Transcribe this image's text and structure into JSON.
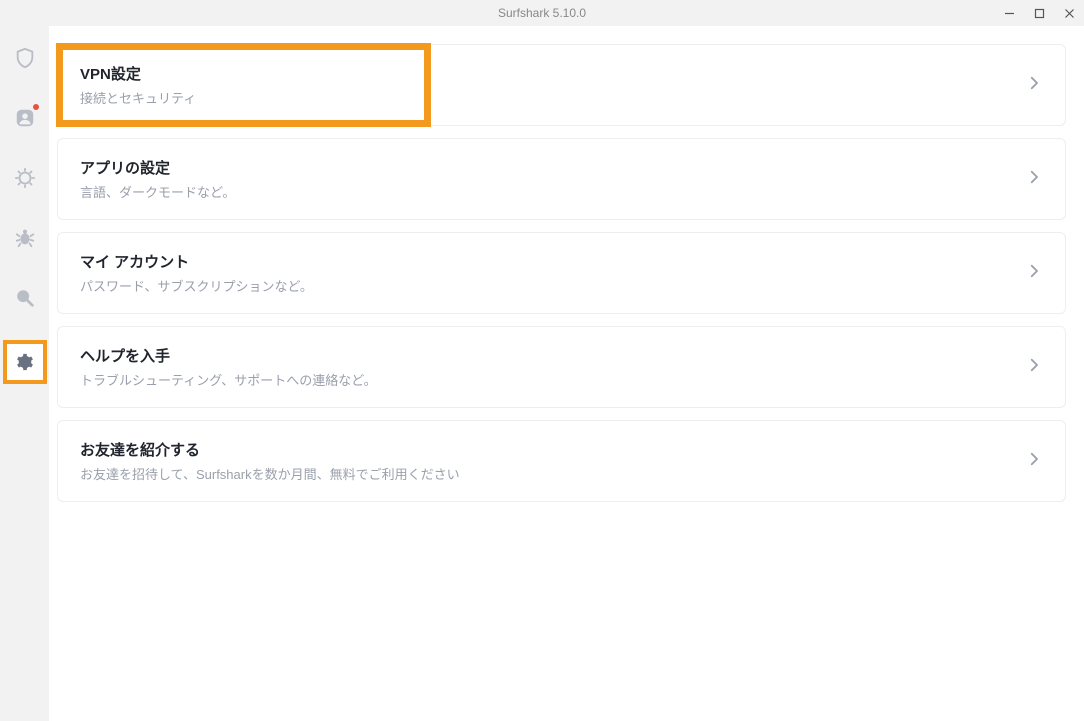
{
  "titlebar": {
    "title": "Surfshark 5.10.0"
  },
  "sidebar": {
    "items": [
      {
        "name": "shield-icon",
        "has_dot": false
      },
      {
        "name": "user-icon",
        "has_dot": true
      },
      {
        "name": "alert-icon",
        "has_dot": false
      },
      {
        "name": "antivirus-icon",
        "has_dot": false
      },
      {
        "name": "search-icon",
        "has_dot": false
      },
      {
        "name": "gear-icon",
        "has_dot": false,
        "highlighted": true
      }
    ]
  },
  "settings": {
    "items": [
      {
        "title": "VPN設定",
        "subtitle": "接続とセキュリティ",
        "highlighted": true
      },
      {
        "title": "アプリの設定",
        "subtitle": "言語、ダークモードなど。",
        "highlighted": false
      },
      {
        "title": "マイ アカウント",
        "subtitle": "パスワード、サブスクリプションなど。",
        "highlighted": false
      },
      {
        "title": "ヘルプを入手",
        "subtitle": "トラブルシューティング、サポートへの連絡など。",
        "highlighted": false
      },
      {
        "title": "お友達を紹介する",
        "subtitle": "お友達を招待して、Surfsharkを数か月間、無料でご利用ください",
        "highlighted": false
      }
    ]
  },
  "colors": {
    "highlight": "#f39a1e",
    "text_primary": "#20242c",
    "text_secondary": "#9aa0ab",
    "icon_muted": "#b9bdc6",
    "notification_dot": "#e5533c"
  }
}
